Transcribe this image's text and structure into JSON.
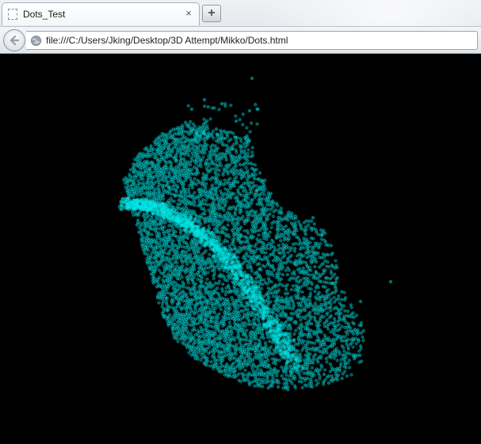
{
  "browser": {
    "tab": {
      "title": "Dots_Test",
      "close_glyph": "×",
      "favicon": "blank-page-icon"
    },
    "new_tab_glyph": "+",
    "nav": {
      "back_icon": "back-arrow-icon",
      "site_icon": "globe-icon",
      "url": "file:///C:/Users/Jking/Desktop/3D Attempt/Mikko/Dots.html"
    }
  },
  "page": {
    "background_color": "#000000",
    "dot_color": "#00e5e5"
  }
}
